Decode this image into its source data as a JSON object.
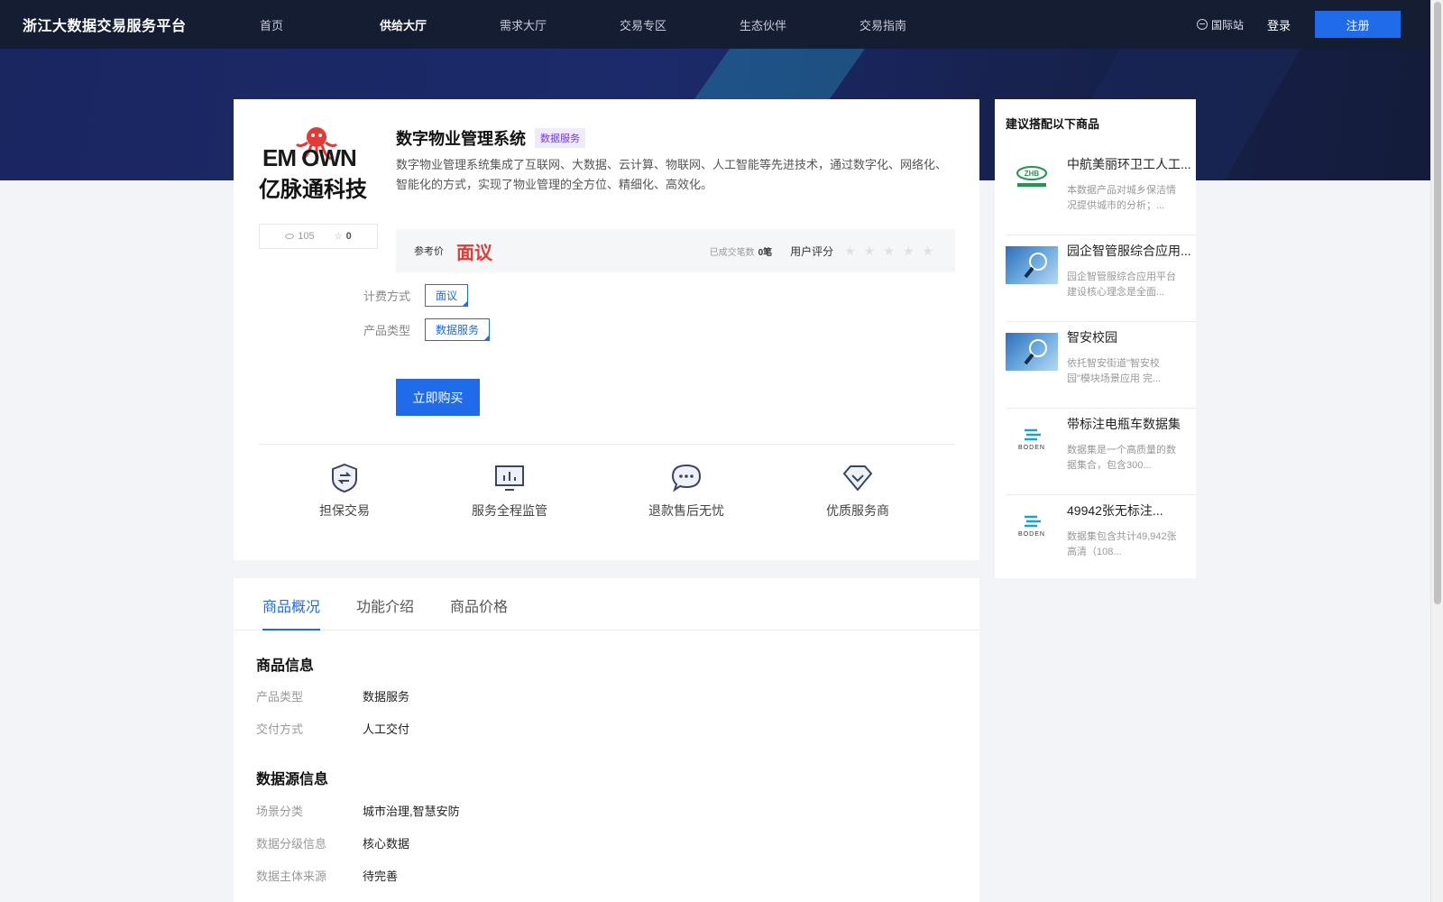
{
  "header": {
    "brand": "浙江大数据交易服务平台",
    "nav": [
      "首页",
      "供给大厅",
      "需求大厅",
      "交易专区",
      "生态伙伴",
      "交易指南"
    ],
    "active_nav": "供给大厅",
    "intl": "国际站",
    "login": "登录",
    "register": "注册"
  },
  "product": {
    "logo_en": "EM  OWN",
    "logo_cn": "亿脉通科技",
    "views": "105",
    "favorites": "0",
    "title": "数字物业管理系统",
    "tag": "数据服务",
    "description": "数字物业管理系统集成了互联网、大数据、云计算、物联网、人工智能等先进技术，通过数字化、网络化、智能化的方式，实现了物业管理的全方位、精细化、高效化。",
    "price_label": "参考价",
    "price_value": "面议",
    "deals_label": "已成交笔数",
    "deals_value": "0笔",
    "rating_label": "用户评分",
    "rating": 0,
    "billing_label": "计费方式",
    "billing_value": "面议",
    "type_label": "产品类型",
    "type_value": "数据服务",
    "buy_label": "立即购买"
  },
  "features": [
    {
      "label": "担保交易",
      "icon": "shield-exchange-icon"
    },
    {
      "label": "服务全程监管",
      "icon": "monitor-chart-icon"
    },
    {
      "label": "退款售后无忧",
      "icon": "chat-bubble-icon"
    },
    {
      "label": "优质服务商",
      "icon": "diamond-check-icon"
    }
  ],
  "tabs": [
    "商品概况",
    "功能介绍",
    "商品价格"
  ],
  "overview": {
    "product_info_title": "商品信息",
    "product_info": [
      {
        "k": "产品类型",
        "v": "数据服务"
      },
      {
        "k": "交付方式",
        "v": "人工交付"
      }
    ],
    "source_info_title": "数据源信息",
    "source_info": [
      {
        "k": "场景分类",
        "v": "城市治理,智慧安防"
      },
      {
        "k": "数据分级信息",
        "v": "核心数据"
      },
      {
        "k": "数据主体来源",
        "v": "待完善"
      }
    ]
  },
  "sidebar": {
    "title": "建议搭配以下商品",
    "items": [
      {
        "name": "中航美丽环卫工人工...",
        "desc": "本数据产品对城乡保洁情况提供城市的分析；...",
        "thumb": "zhb-logo"
      },
      {
        "name": "园企智管服综合应用...",
        "desc": "园企智管服综合应用平台建设核心理念是全面...",
        "thumb": "magnifier-photo"
      },
      {
        "name": "智安校园",
        "desc": "依托智安街道\"智安校园\"模块场景应用 完...",
        "thumb": "magnifier-photo"
      },
      {
        "name": "带标注电瓶车数据集",
        "desc": "数据集是一个高质量的数据集合，包含300...",
        "thumb": "bodenai-logo"
      },
      {
        "name": "49942张无标注...",
        "desc": "数据集包含共计49,942张高清（108...",
        "thumb": "bodenai-logo"
      }
    ]
  },
  "colors": {
    "accent": "#1f6bea",
    "price": "#e53935",
    "nav_bg": "#151d33"
  }
}
